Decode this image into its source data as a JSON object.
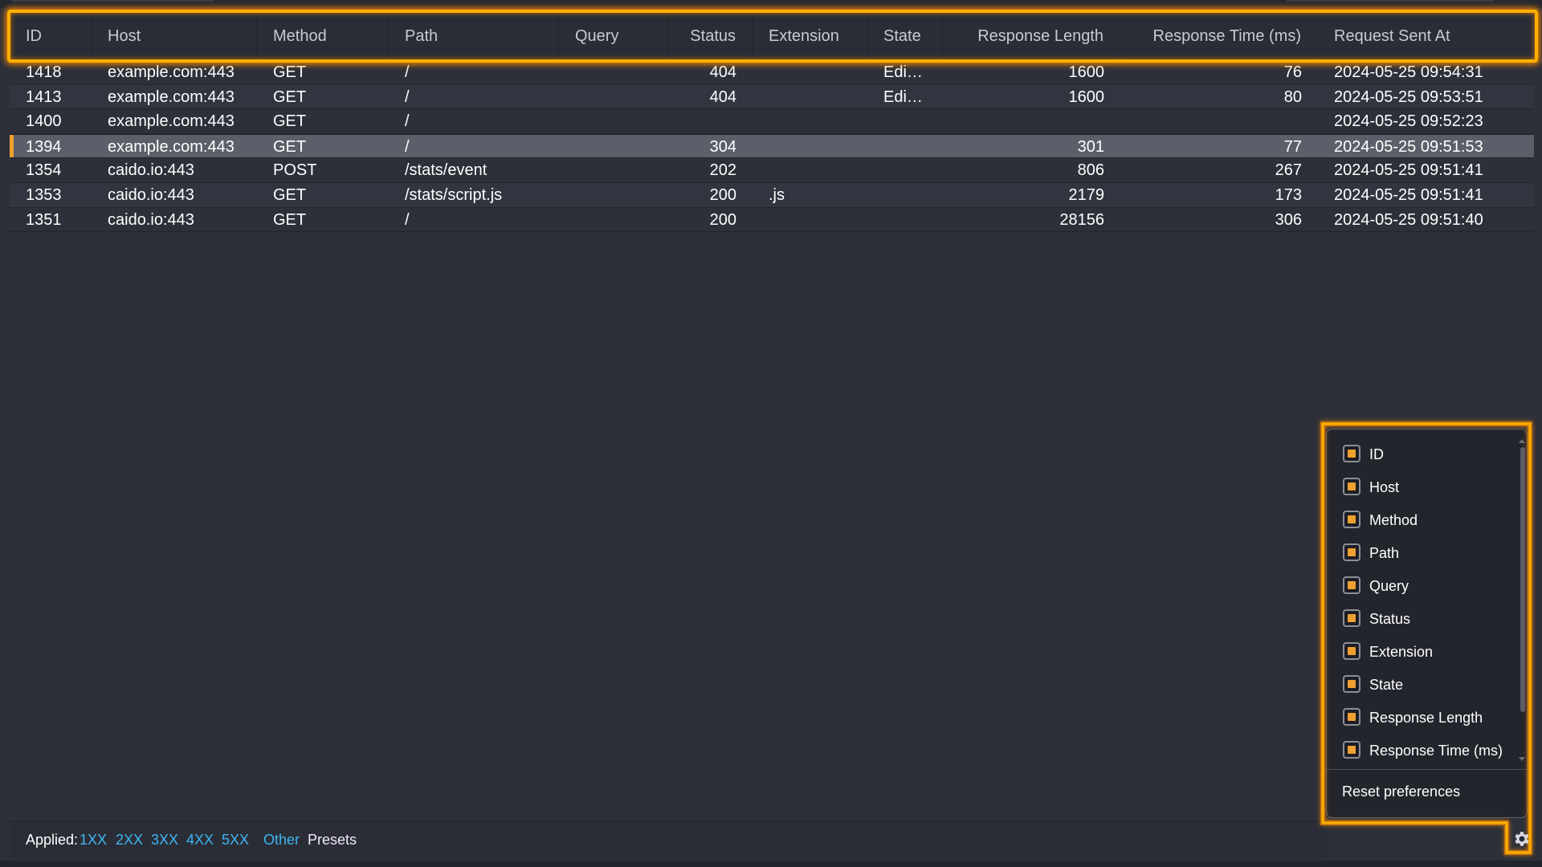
{
  "table": {
    "columns": [
      {
        "key": "id",
        "label": "ID"
      },
      {
        "key": "host",
        "label": "Host"
      },
      {
        "key": "method",
        "label": "Method"
      },
      {
        "key": "path",
        "label": "Path"
      },
      {
        "key": "query",
        "label": "Query"
      },
      {
        "key": "status",
        "label": "Status"
      },
      {
        "key": "extension",
        "label": "Extension"
      },
      {
        "key": "state",
        "label": "State"
      },
      {
        "key": "response_length",
        "label": "Response Length"
      },
      {
        "key": "response_time",
        "label": "Response Time (ms)"
      },
      {
        "key": "sent_at",
        "label": "Request Sent At"
      }
    ],
    "rows": [
      {
        "id": "1418",
        "host": "example.com:443",
        "method": "GET",
        "path": "/",
        "query": "",
        "status": "404",
        "extension": "",
        "state": "Edi…",
        "response_length": "1600",
        "response_time": "76",
        "sent_at": "2024-05-25 09:54:31",
        "selected": false
      },
      {
        "id": "1413",
        "host": "example.com:443",
        "method": "GET",
        "path": "/",
        "query": "",
        "status": "404",
        "extension": "",
        "state": "Edi…",
        "response_length": "1600",
        "response_time": "80",
        "sent_at": "2024-05-25 09:53:51",
        "selected": false
      },
      {
        "id": "1400",
        "host": "example.com:443",
        "method": "GET",
        "path": "/",
        "query": "",
        "status": "",
        "extension": "",
        "state": "",
        "response_length": "",
        "response_time": "",
        "sent_at": "2024-05-25 09:52:23",
        "selected": false
      },
      {
        "id": "1394",
        "host": "example.com:443",
        "method": "GET",
        "path": "/",
        "query": "",
        "status": "304",
        "extension": "",
        "state": "",
        "response_length": "301",
        "response_time": "77",
        "sent_at": "2024-05-25 09:51:53",
        "selected": true
      },
      {
        "id": "1354",
        "host": "caido.io:443",
        "method": "POST",
        "path": "/stats/event",
        "query": "",
        "status": "202",
        "extension": "",
        "state": "",
        "response_length": "806",
        "response_time": "267",
        "sent_at": "2024-05-25 09:51:41",
        "selected": false
      },
      {
        "id": "1353",
        "host": "caido.io:443",
        "method": "GET",
        "path": "/stats/script.js",
        "query": "",
        "status": "200",
        "extension": ".js",
        "state": "",
        "response_length": "2179",
        "response_time": "173",
        "sent_at": "2024-05-25 09:51:41",
        "selected": false
      },
      {
        "id": "1351",
        "host": "caido.io:443",
        "method": "GET",
        "path": "/",
        "query": "",
        "status": "200",
        "extension": "",
        "state": "",
        "response_length": "28156",
        "response_time": "306",
        "sent_at": "2024-05-25 09:51:40",
        "selected": false
      }
    ]
  },
  "footer": {
    "applied_label": "Applied:",
    "filters": [
      "1XX",
      "2XX",
      "3XX",
      "4XX",
      "5XX",
      "Other"
    ],
    "presets_label": "Presets",
    "settings_icon": "gear-icon"
  },
  "column_menu": {
    "items": [
      {
        "label": "ID",
        "checked": true
      },
      {
        "label": "Host",
        "checked": true
      },
      {
        "label": "Method",
        "checked": true
      },
      {
        "label": "Path",
        "checked": true
      },
      {
        "label": "Query",
        "checked": true
      },
      {
        "label": "Status",
        "checked": true
      },
      {
        "label": "Extension",
        "checked": true
      },
      {
        "label": "State",
        "checked": true
      },
      {
        "label": "Response Length",
        "checked": true
      },
      {
        "label": "Response Time (ms)",
        "checked": true
      }
    ],
    "reset_label": "Reset preferences"
  },
  "colors": {
    "accent": "#f0a030",
    "highlight": "#ffb000",
    "link": "#3fb4f0",
    "background": "#2d3039"
  }
}
